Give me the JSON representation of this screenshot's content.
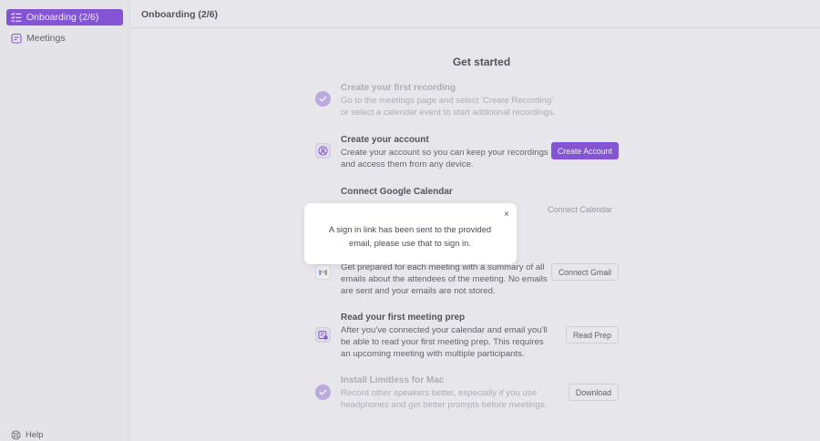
{
  "sidebar": {
    "items": [
      {
        "label": "Onboarding (2/6)",
        "icon": "checklist-icon",
        "active": true
      },
      {
        "label": "Meetings",
        "icon": "calendar-icon",
        "active": false
      }
    ],
    "help_label": "Help"
  },
  "header": {
    "title": "Onboarding (2/6)"
  },
  "main": {
    "heading": "Get started",
    "steps": [
      {
        "title": "Create your first recording",
        "desc": "Go to the meetings page and select 'Create Recording' or select a calendar event to start additional recordings.",
        "icon": "check-icon",
        "completed": true
      },
      {
        "title": "Create your account",
        "desc": "Create your account so you can keep your recordings and access them from any device.",
        "icon": "user-circle-icon",
        "completed": false,
        "button": "Create Account"
      },
      {
        "title": "Connect Google Calendar",
        "desc": "",
        "icon": "calendar-icon",
        "completed": false,
        "button": "Connect Calendar"
      },
      {
        "title": "",
        "desc": "Get prepared for each meeting with a summary of all emails about the attendees of the meeting. No emails are sent and your emails are not stored.",
        "icon": "gmail-icon",
        "completed": false,
        "button": "Connect Gmail"
      },
      {
        "title": "Read your first meeting prep",
        "desc": "After you've connected your calendar and email you'll be able to read your first meeting prep. This requires an upcoming meeting with multiple participants.",
        "icon": "meeting-prep-icon",
        "completed": false,
        "button": "Read Prep"
      },
      {
        "title": "Install Limitless for Mac",
        "desc": "Record other speakers better, especially if you use headphones and get better prompts before meetings.",
        "icon": "check-icon",
        "completed": true,
        "button": "Download"
      }
    ]
  },
  "toast": {
    "message": "A sign in link has been sent to the provided email, please use that to sign in.",
    "close_glyph": "×"
  },
  "colors": {
    "accent": "#6d2bd9",
    "check_bg": "#b9a3e8"
  }
}
